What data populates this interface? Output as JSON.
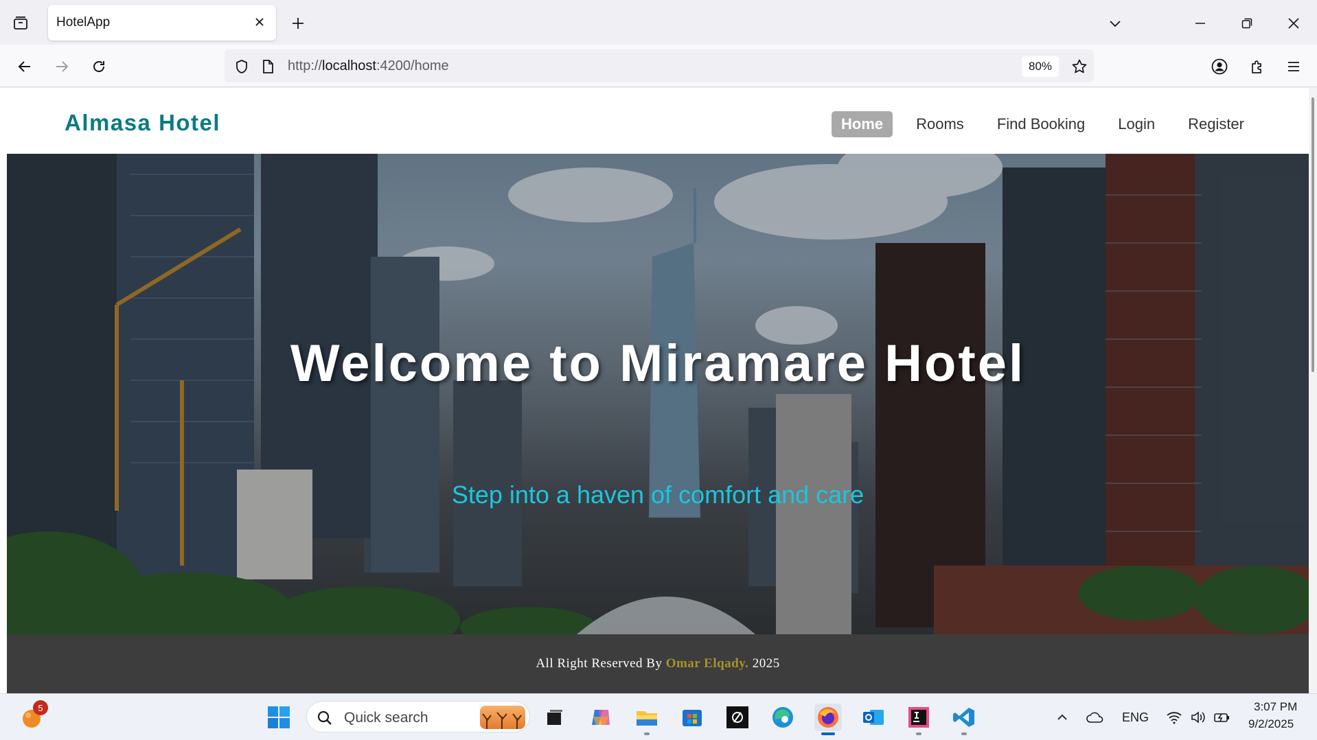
{
  "browser": {
    "tab": {
      "title": "HotelApp"
    },
    "url": {
      "scheme": "http://",
      "host": "localhost",
      "rest": ":4200/home"
    },
    "zoom": "80%"
  },
  "site": {
    "brand": "Almasa Hotel",
    "nav": [
      {
        "label": "Home",
        "active": true
      },
      {
        "label": "Rooms",
        "active": false
      },
      {
        "label": "Find Booking",
        "active": false
      },
      {
        "label": "Login",
        "active": false
      },
      {
        "label": "Register",
        "active": false
      }
    ],
    "hero": {
      "title": "Welcome to Miramare Hotel",
      "subtitle": "Step into a haven of comfort and care"
    },
    "footer": {
      "prefix": "All Right Reserved By",
      "author": "Omar Elqady.",
      "year": "2025"
    }
  },
  "taskbar": {
    "search_placeholder": "Quick search",
    "notification_count": "5",
    "language": "ENG",
    "time": "3:07 PM",
    "date": "9/2/2025"
  },
  "colors": {
    "brand": "#0b7b82",
    "subtitle": "#19c7de",
    "footer_author": "#a89326",
    "active_nav_bg": "#a9a9a9"
  }
}
